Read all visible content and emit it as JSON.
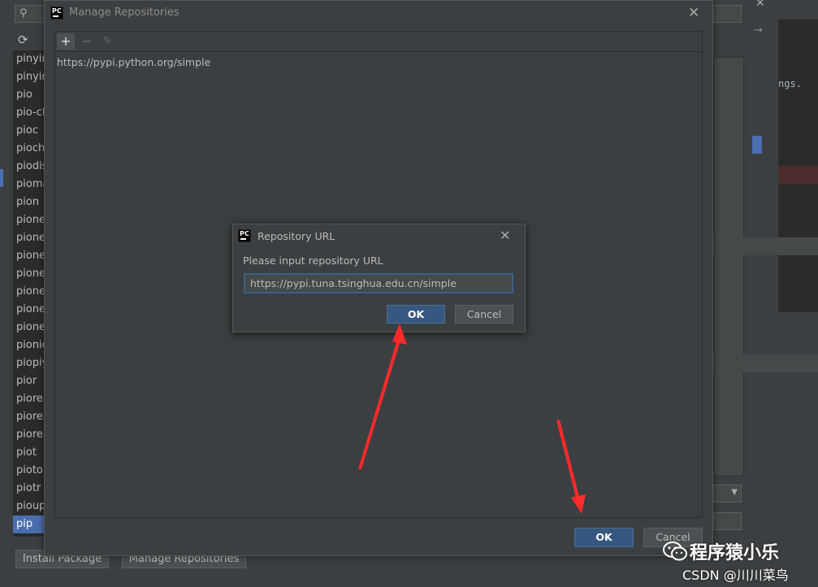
{
  "background": {
    "search_icon": "search-icon",
    "refresh_icon": "refresh-icon",
    "packages": [
      "pinyin",
      "pinyin",
      "pio",
      "pio-cl",
      "pioc",
      "piochr",
      "piodis",
      "pioma",
      "pion",
      "pione",
      "pione",
      "pione",
      "pione",
      "pione",
      "pione",
      "pione",
      "pionic",
      "piopiy",
      "pior",
      "piorea",
      "piorea",
      "piorea",
      "piot",
      "pioton",
      "piotr",
      "pioup",
      "pip"
    ],
    "selected_package": "pip",
    "install_button": "Install Package",
    "manage_button": "Manage Repositories",
    "right_editor_text": "ngs."
  },
  "manage_dialog": {
    "title": "Manage Repositories",
    "toolbar": {
      "add": "+",
      "remove": "−",
      "edit_icon": "pencil-icon"
    },
    "repositories": [
      "https://pypi.python.org/simple"
    ],
    "ok_label": "OK",
    "cancel_label": "Cancel"
  },
  "url_dialog": {
    "title": "Repository URL",
    "prompt": "Please input repository URL",
    "input_value": "https://pypi.tuna.tsinghua.edu.cn/simple",
    "ok_label": "OK",
    "cancel_label": "Cancel"
  },
  "watermark": {
    "name": "程序猿小乐",
    "author": "CSDN @川川菜鸟"
  },
  "colors": {
    "accent_blue": "#365880",
    "selection": "#4b6eaf",
    "annotation_red": "#ff2a2a"
  }
}
